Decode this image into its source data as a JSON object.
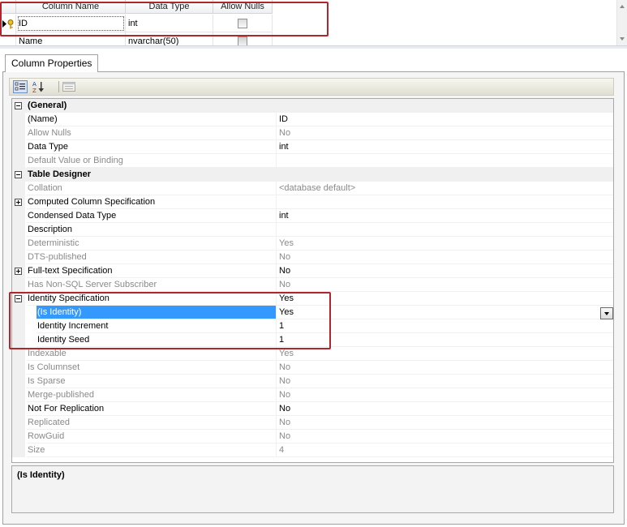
{
  "grid": {
    "headers": [
      "Column Name",
      "Data Type",
      "Allow Nulls"
    ],
    "rows": [
      {
        "name": "ID",
        "type": "int",
        "allow_nulls": false
      },
      {
        "name": "Name",
        "type": "nvarchar(50)",
        "allow_nulls": true
      }
    ]
  },
  "panel": {
    "tab_label": "Column Properties",
    "toolbar_icons": [
      "categorized-icon",
      "alphabetical-sort-icon",
      "property-pages-icon"
    ]
  },
  "properties": [
    {
      "label": "(General)",
      "value": "",
      "type": "category",
      "expander": "minus"
    },
    {
      "label": "(Name)",
      "value": "ID"
    },
    {
      "label": "Allow Nulls",
      "value": "No",
      "readonly": true
    },
    {
      "label": "Data Type",
      "value": "int"
    },
    {
      "label": "Default Value or Binding",
      "value": "",
      "readonly": true
    },
    {
      "label": "Table Designer",
      "value": "",
      "type": "category",
      "expander": "minus"
    },
    {
      "label": "Collation",
      "value": "<database default>",
      "readonly": true
    },
    {
      "label": "Computed Column Specification",
      "value": "",
      "expander": "plus"
    },
    {
      "label": "Condensed Data Type",
      "value": "int"
    },
    {
      "label": "Description",
      "value": ""
    },
    {
      "label": "Deterministic",
      "value": "Yes",
      "readonly": true
    },
    {
      "label": "DTS-published",
      "value": "No",
      "readonly": true
    },
    {
      "label": "Full-text Specification",
      "value": "No",
      "expander": "plus"
    },
    {
      "label": "Has Non-SQL Server Subscriber",
      "value": "No",
      "readonly": true
    },
    {
      "label": "Identity Specification",
      "value": "Yes",
      "expander": "minus"
    },
    {
      "label": "(Is Identity)",
      "value": "Yes",
      "indent": 1,
      "selected": true
    },
    {
      "label": "Identity Increment",
      "value": "1",
      "indent": 1
    },
    {
      "label": "Identity Seed",
      "value": "1",
      "indent": 1
    },
    {
      "label": "Indexable",
      "value": "Yes",
      "readonly": true
    },
    {
      "label": "Is Columnset",
      "value": "No",
      "readonly": true
    },
    {
      "label": "Is Sparse",
      "value": "No",
      "readonly": true
    },
    {
      "label": "Merge-published",
      "value": "No",
      "readonly": true
    },
    {
      "label": "Not For Replication",
      "value": "No"
    },
    {
      "label": "Replicated",
      "value": "No",
      "readonly": true
    },
    {
      "label": "RowGuid",
      "value": "No",
      "readonly": true
    },
    {
      "label": "Size",
      "value": "4",
      "readonly": true
    }
  ],
  "description": {
    "title": "(Is Identity)"
  },
  "colors": {
    "highlight": "#b0262c",
    "selection": "#3399ff",
    "readonly_text": "#8a8a8a"
  }
}
